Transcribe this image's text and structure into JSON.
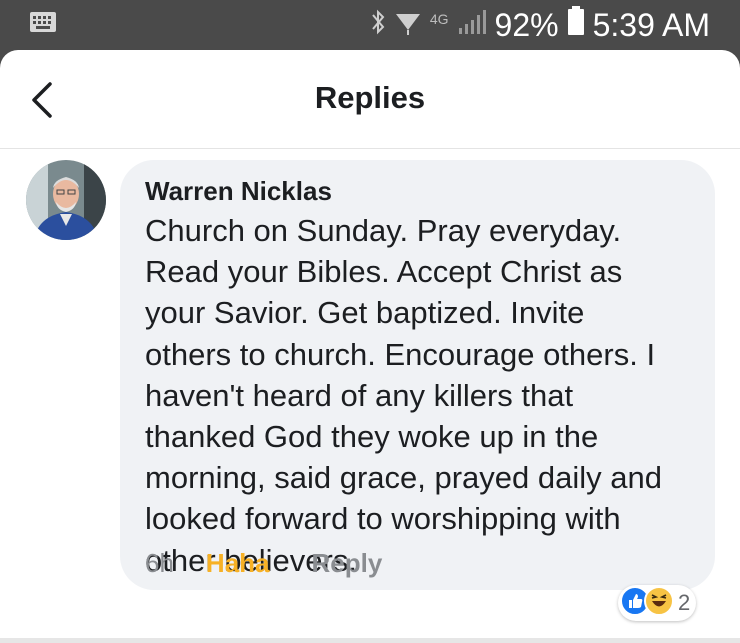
{
  "status_bar": {
    "network": "4G",
    "battery": "92%",
    "time": "5:39 AM",
    "icons": [
      "keyboard-icon",
      "bluetooth-icon",
      "wifi-icon",
      "signal-icon",
      "battery-icon"
    ]
  },
  "header": {
    "title": "Replies",
    "back_icon": "chevron-left-icon"
  },
  "comment": {
    "author": "Warren Nicklas",
    "lines": [
      "Church on Sunday. Pray everyday.",
      "Read your Bibles. Accept Christ as",
      "your Savior. Get baptized. Invite",
      "others to church. Encourage others. I",
      "haven't heard of any killers that",
      "thanked God they woke up in the",
      "morning, said grace, prayed daily and",
      "looked forward to worshipping with",
      "other believers."
    ],
    "time": "6h",
    "reaction_label": "Haha",
    "reply_label": "Reply",
    "reaction_count": "2",
    "reaction_icons": [
      "like-icon",
      "haha-icon"
    ]
  },
  "colors": {
    "haha_accent": "#f7b125",
    "bubble": "#f0f2f5",
    "like_blue": "#1877f2"
  }
}
